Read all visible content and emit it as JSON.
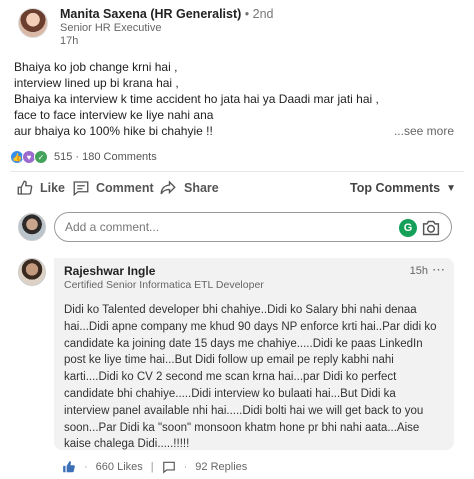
{
  "post": {
    "author_name": "Manita Saxena (HR Generalist)",
    "author_degree": " • 2nd",
    "author_title": "Senior HR Executive",
    "time": "17h",
    "lines": [
      "Bhaiya ko job change krni hai ,",
      "interview lined up bi krana hai ,",
      "Bhaiya ka interview k time accident ho jata hai ya Daadi mar jati hai ,",
      "face to face interview ke liye nahi ana",
      "aur bhaiya ko 100% hike bi chahyie !!"
    ],
    "see_more": "...see more",
    "reactions_count": "515",
    "comments_count": "180 Comments",
    "counts_sep": " · "
  },
  "actions": {
    "like": "Like",
    "comment": "Comment",
    "share": "Share",
    "sort": "Top Comments"
  },
  "comment_input": {
    "placeholder": "Add a comment..."
  },
  "comment": {
    "name": "Rajeshwar Ingle",
    "title": "Certified Senior Informatica ETL Developer",
    "time": "15h",
    "lines": [
      "Didi ko Talented developer bhi chahiye..Didi ko Salary bhi nahi denaa",
      "hai...Didi apne company me khud 90 days NP enforce krti hai..Par didi ko",
      "candidate ka joining date 15 days me chahiye.....Didi ke paas LinkedIn",
      "post ke liye time hai...But Didi follow up email pe reply kabhi nahi",
      "karti....Didi ko CV 2 second me scan krna hai...par Didi ko perfect",
      "candidate bhi chahiye.....Didi interview ko bulaati hai...But Didi ka",
      "interview panel available nhi hai.....Didi bolti hai we will get back to you",
      "soon...Par Didi ka \"soon\" monsoon khatm hone pr bhi nahi aata...Aise",
      "kaise chalega Didi.....!!!!!"
    ],
    "likes": "660 Likes",
    "replies": "92 Replies"
  }
}
